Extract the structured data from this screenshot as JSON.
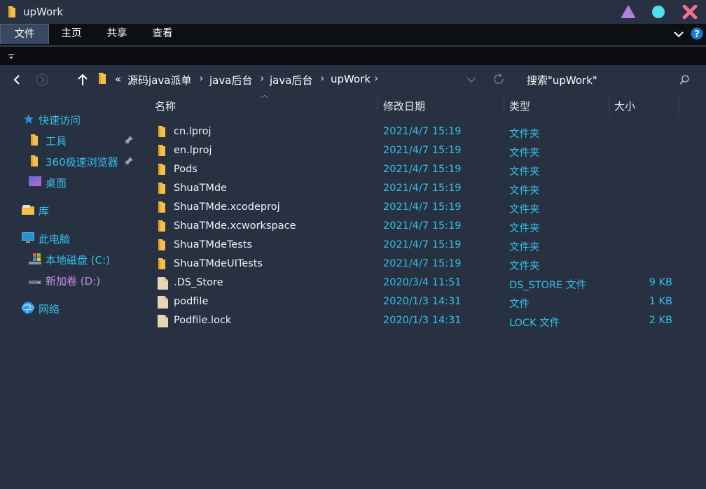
{
  "window": {
    "title": "upWork"
  },
  "ribbon": {
    "tabs": [
      "文件",
      "主页",
      "共享",
      "查看"
    ],
    "active": 0
  },
  "breadcrumb": {
    "overflow": "«",
    "items": [
      "源码java派单",
      "java后台",
      "java后台",
      "upWork"
    ]
  },
  "search": {
    "placeholder": "搜索\"upWork\""
  },
  "columns": {
    "name": "名称",
    "date": "修改日期",
    "type": "类型",
    "size": "大小"
  },
  "sidebar": {
    "quick_access": "快速访问",
    "quick_items": [
      "工具",
      "360极速浏览器"
    ],
    "desktop": "桌面",
    "library": "库",
    "this_pc": "此电脑",
    "drive_c": "本地磁盘 (C:)",
    "drive_d": "新加卷 (D:)",
    "network": "网络"
  },
  "files": [
    {
      "name": "cn.lproj",
      "date": "2021/4/7 15:19",
      "type": "文件夹",
      "size": "",
      "kind": "folder"
    },
    {
      "name": "en.lproj",
      "date": "2021/4/7 15:19",
      "type": "文件夹",
      "size": "",
      "kind": "folder"
    },
    {
      "name": "Pods",
      "date": "2021/4/7 15:19",
      "type": "文件夹",
      "size": "",
      "kind": "folder"
    },
    {
      "name": "ShuaTMde",
      "date": "2021/4/7 15:19",
      "type": "文件夹",
      "size": "",
      "kind": "folder"
    },
    {
      "name": "ShuaTMde.xcodeproj",
      "date": "2021/4/7 15:19",
      "type": "文件夹",
      "size": "",
      "kind": "folder"
    },
    {
      "name": "ShuaTMde.xcworkspace",
      "date": "2021/4/7 15:19",
      "type": "文件夹",
      "size": "",
      "kind": "folder"
    },
    {
      "name": "ShuaTMdeTests",
      "date": "2021/4/7 15:19",
      "type": "文件夹",
      "size": "",
      "kind": "folder"
    },
    {
      "name": "ShuaTMdeUITests",
      "date": "2021/4/7 15:19",
      "type": "文件夹",
      "size": "",
      "kind": "folder"
    },
    {
      "name": ".DS_Store",
      "date": "2020/3/4 11:51",
      "type": "DS_STORE 文件",
      "size": "9 KB",
      "kind": "file"
    },
    {
      "name": "podfile",
      "date": "2020/1/3 14:31",
      "type": "文件",
      "size": "1 KB",
      "kind": "file"
    },
    {
      "name": "Podfile.lock",
      "date": "2020/1/3 14:31",
      "type": "LOCK 文件",
      "size": "2 KB",
      "kind": "file"
    }
  ],
  "colors": {
    "background": "#273142",
    "accent_text": "#34c0e8",
    "folder": "#f5c04a",
    "drive_d_text": "#c78ce6",
    "minimize": "#b77ee0",
    "maximize": "#4fe0ee",
    "close": "#f0728a"
  }
}
